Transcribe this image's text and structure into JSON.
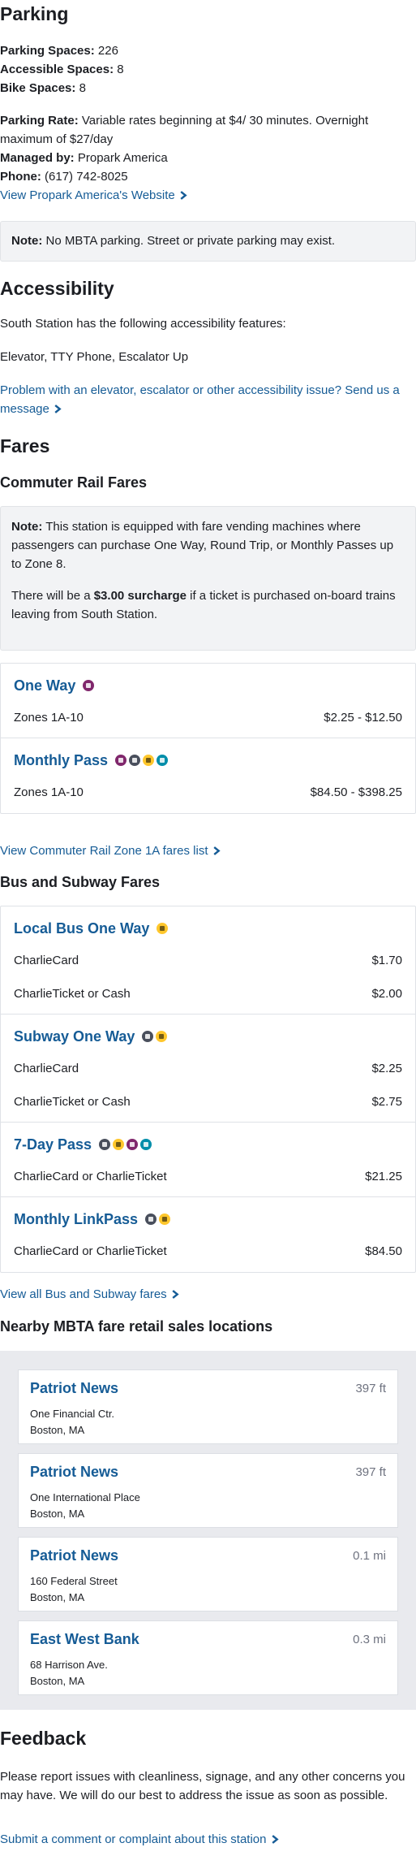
{
  "parking": {
    "heading": "Parking",
    "spaces_label": "Parking Spaces:",
    "spaces_value": "226",
    "accessible_label": "Accessible Spaces:",
    "accessible_value": "8",
    "bike_label": "Bike Spaces:",
    "bike_value": "8",
    "rate_label": "Parking Rate:",
    "rate_value": "Variable rates beginning at $4/ 30 minutes. Overnight maximum of $27/day",
    "managed_label": "Managed by:",
    "managed_value": "Propark America",
    "phone_label": "Phone:",
    "phone_value": "(617) 742-8025",
    "website_link": "View Propark America's Website",
    "note_label": "Note:",
    "note_text": "No MBTA parking. Street or private parking may exist."
  },
  "accessibility": {
    "heading": "Accessibility",
    "intro": "South Station has the following accessibility features:",
    "features": "Elevator, TTY Phone, Escalator Up",
    "report_link": "Problem with an elevator, escalator or other accessibility issue? Send us a message"
  },
  "fares": {
    "heading": "Fares",
    "commuter_heading": "Commuter Rail Fares",
    "commuter_note_label": "Note:",
    "commuter_note_text": "This station is equipped with fare vending machines where passengers can purchase One Way, Round Trip, or Monthly Passes up to Zone 8.",
    "surcharge_pre": "There will be a",
    "surcharge_amount": "$3.00 surcharge",
    "surcharge_post": "if a ticket is purchased on-board trains leaving from South Station.",
    "commuter_cards": [
      {
        "title": "One Way",
        "rows": [
          {
            "label": "Zones 1A-10",
            "value": "$2.25 - $12.50"
          }
        ]
      },
      {
        "title": "Monthly Pass",
        "rows": [
          {
            "label": "Zones 1A-10",
            "value": "$84.50 - $398.25"
          }
        ]
      }
    ],
    "commuter_link": "View Commuter Rail Zone 1A fares list",
    "bus_heading": "Bus and Subway Fares",
    "bus_cards": [
      {
        "title": "Local Bus One Way",
        "rows": [
          {
            "label": "CharlieCard",
            "value": "$1.70"
          },
          {
            "label": "CharlieTicket or Cash",
            "value": "$2.00"
          }
        ]
      },
      {
        "title": "Subway One Way",
        "rows": [
          {
            "label": "CharlieCard",
            "value": "$2.25"
          },
          {
            "label": "CharlieTicket or Cash",
            "value": "$2.75"
          }
        ]
      },
      {
        "title": "7-Day Pass",
        "rows": [
          {
            "label": "CharlieCard or CharlieTicket",
            "value": "$21.25"
          }
        ]
      },
      {
        "title": "Monthly LinkPass",
        "rows": [
          {
            "label": "CharlieCard or CharlieTicket",
            "value": "$84.50"
          }
        ]
      }
    ],
    "bus_link": "View all Bus and Subway fares",
    "sales_heading": "Nearby MBTA fare retail sales locations",
    "sales": [
      {
        "name": "Patriot News",
        "distance": "397 ft",
        "address1": "One Financial Ctr.",
        "address2": "Boston, MA"
      },
      {
        "name": "Patriot News",
        "distance": "397 ft",
        "address1": "One International Place",
        "address2": "Boston, MA"
      },
      {
        "name": "Patriot News",
        "distance": "0.1 mi",
        "address1": "160 Federal Street",
        "address2": "Boston, MA"
      },
      {
        "name": "East West Bank",
        "distance": "0.3 mi",
        "address1": "68 Harrison Ave.",
        "address2": "Boston, MA"
      }
    ]
  },
  "feedback": {
    "heading": "Feedback",
    "text": "Please report issues with cleanliness, signage, and any other concerns you may have. We will do our best to address the issue as soon as possible.",
    "link": "Submit a comment or complaint about this station"
  },
  "icon_names": [
    "commuter-rail-icon",
    "subway-icon",
    "bus-icon",
    "ferry-icon",
    "arrow-right-icon"
  ],
  "colors": {
    "link": "#165c96",
    "commuter_rail": "#80276c",
    "subway": "#494f5c",
    "bus": "#ffc72c",
    "ferry": "#008eaa",
    "note_bg": "#f2f3f5",
    "sales_bg": "#e9eaee"
  }
}
